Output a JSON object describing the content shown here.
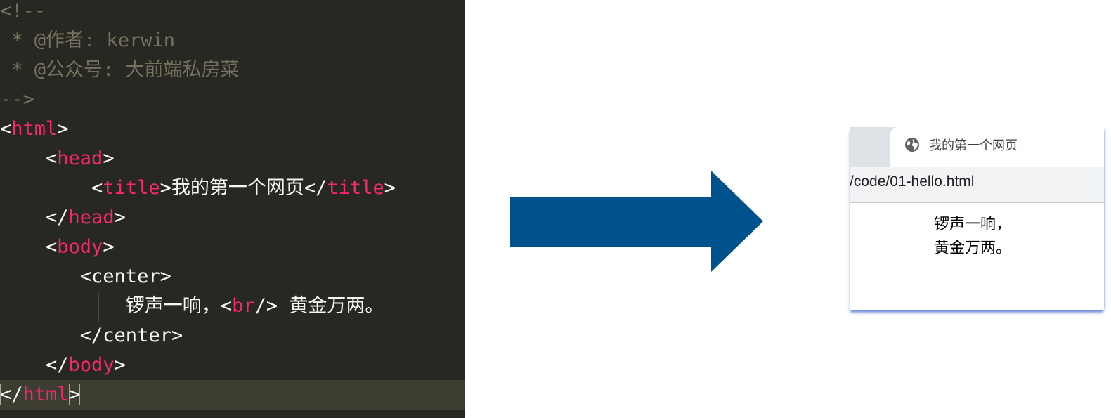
{
  "editor": {
    "lines": [
      {
        "tokens": [
          {
            "t": "<!--",
            "k": "comment"
          }
        ]
      },
      {
        "tokens": [
          {
            "t": " * @作者: kerwin",
            "k": "comment"
          }
        ]
      },
      {
        "tokens": [
          {
            "t": " * @公众号: 大前端私房菜",
            "k": "comment"
          }
        ]
      },
      {
        "tokens": [
          {
            "t": "-->",
            "k": "comment"
          }
        ]
      },
      {
        "tokens": [
          {
            "t": "<",
            "k": "punc"
          },
          {
            "t": "html",
            "k": "tag"
          },
          {
            "t": ">",
            "k": "punc"
          }
        ]
      },
      {
        "tokens": [
          {
            "t": "    <",
            "k": "punc"
          },
          {
            "t": "head",
            "k": "tag"
          },
          {
            "t": ">",
            "k": "punc"
          }
        ]
      },
      {
        "tokens": [
          {
            "t": "        <",
            "k": "punc"
          },
          {
            "t": "title",
            "k": "tag"
          },
          {
            "t": ">",
            "k": "punc"
          },
          {
            "t": "我的第一个网页",
            "k": "text"
          },
          {
            "t": "</",
            "k": "punc"
          },
          {
            "t": "title",
            "k": "tag"
          },
          {
            "t": ">",
            "k": "punc"
          }
        ]
      },
      {
        "tokens": [
          {
            "t": "    </",
            "k": "punc"
          },
          {
            "t": "head",
            "k": "tag"
          },
          {
            "t": ">",
            "k": "punc"
          }
        ]
      },
      {
        "tokens": [
          {
            "t": "    <",
            "k": "punc"
          },
          {
            "t": "body",
            "k": "tag"
          },
          {
            "t": ">",
            "k": "punc"
          }
        ]
      },
      {
        "tokens": [
          {
            "t": "       <center>",
            "k": "text"
          }
        ]
      },
      {
        "tokens": [
          {
            "t": "           锣声一响，<",
            "k": "text"
          },
          {
            "t": "br",
            "k": "tag"
          },
          {
            "t": "/> 黄金万两。",
            "k": "text"
          }
        ]
      },
      {
        "tokens": [
          {
            "t": "       </center>",
            "k": "text"
          }
        ]
      },
      {
        "tokens": [
          {
            "t": "    </",
            "k": "punc"
          },
          {
            "t": "body",
            "k": "tag"
          },
          {
            "t": ">",
            "k": "punc"
          }
        ]
      },
      {
        "tokens": [
          {
            "t": "<",
            "k": "punc",
            "boxed": true
          },
          {
            "t": "/",
            "k": "punc"
          },
          {
            "t": "html",
            "k": "tag"
          },
          {
            "t": ">",
            "k": "punc",
            "boxed": true
          }
        ],
        "active": true
      }
    ]
  },
  "arrow": {
    "color": "#00528c"
  },
  "browser": {
    "tab_title": "我的第一个网页",
    "tab_icon": "globe-icon",
    "url": "/code/01-hello.html",
    "content": [
      "锣声一响，",
      "黄金万两。"
    ]
  },
  "colors": {
    "editor_bg": "#272822",
    "comment": "#75715e",
    "tag": "#f92672",
    "text": "#f8f8f2",
    "active_line": "#3e3d32"
  }
}
